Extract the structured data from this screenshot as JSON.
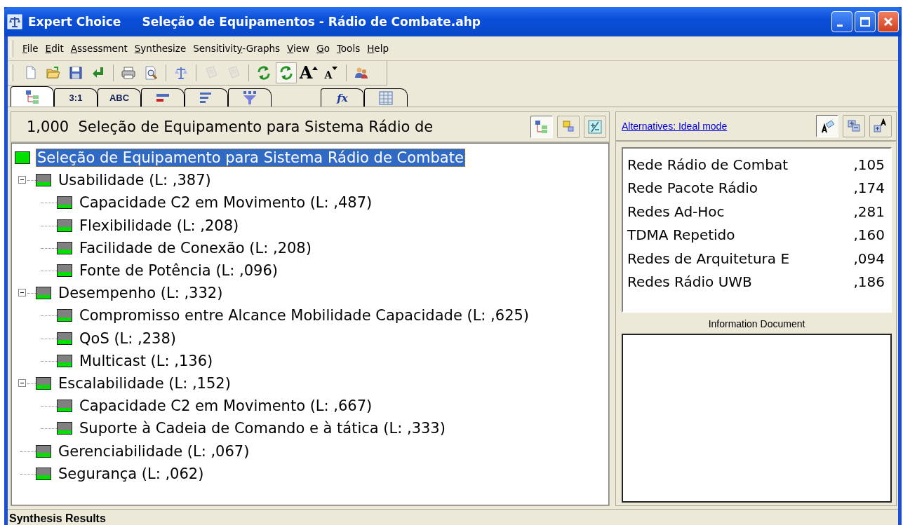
{
  "window": {
    "app": "Expert Choice",
    "title": "Seleção de Equipamentos - Rádio de Combate.ahp"
  },
  "menu": [
    {
      "key": "F",
      "post": "ile"
    },
    {
      "key": "E",
      "post": "dit"
    },
    {
      "key": "A",
      "post": "ssessment"
    },
    {
      "key": "S",
      "post": "ynthesize"
    },
    {
      "pre": "Sensitivit",
      "key": "y",
      "post": "-Graphs"
    },
    {
      "key": "V",
      "post": "iew"
    },
    {
      "key": "G",
      "post": "o"
    },
    {
      "key": "T",
      "post": "ools"
    },
    {
      "key": "H",
      "post": "elp"
    }
  ],
  "toolbar": [
    [
      {
        "pressed": false,
        "disabled": false
      },
      {
        "pressed": false,
        "disabled": false
      },
      {
        "pressed": false,
        "disabled": false
      },
      {
        "pressed": false,
        "disabled": false
      }
    ],
    [
      {
        "pressed": false,
        "disabled": false
      },
      {
        "pressed": false,
        "disabled": false
      }
    ],
    [
      {
        "pressed": false,
        "disabled": false
      }
    ],
    [
      {
        "pressed": false,
        "disabled": true
      },
      {
        "pressed": false,
        "disabled": true
      }
    ],
    [
      {
        "pressed": false,
        "disabled": false
      },
      {
        "pressed": true,
        "disabled": false
      },
      {
        "label": "A",
        "pressed": false,
        "disabled": false
      },
      {
        "label": "A",
        "pressed": false,
        "disabled": false
      }
    ],
    [
      {
        "pressed": false,
        "disabled": false
      }
    ]
  ],
  "tabs": [
    {
      "selected": true
    },
    {
      "label": "3:1",
      "selected": false
    },
    {
      "label": "ABC",
      "selected": false
    },
    {
      "selected": false
    },
    {
      "selected": false
    },
    {
      "selected": false
    },
    {
      "label": "fx",
      "selected": false
    },
    {
      "selected": false
    }
  ],
  "tree_pane": {
    "header": {
      "value": "1,000",
      "label": "Seleção de Equipamento para Sistema Rádio de"
    },
    "view_buttons": [
      {
        "pressed": true
      },
      {
        "pressed": false
      },
      {
        "pressed": false
      }
    ],
    "tree": {
      "label": "Seleção de Equipamento para Sistema Rádio de Combate",
      "selected": true,
      "children": [
        {
          "label": "Usabilidade (L: ,387)",
          "expanded": true,
          "selected": false,
          "children": [
            {
              "label": "Capacidade C2 em Movimento (L: ,487)",
              "selected": false
            },
            {
              "label": "Flexibilidade (L: ,208)",
              "selected": false
            },
            {
              "label": "Facilidade de Conexão (L: ,208)",
              "selected": false
            },
            {
              "label": "Fonte de Potência (L: ,096)",
              "selected": false
            }
          ]
        },
        {
          "label": "Desempenho (L: ,332)",
          "expanded": true,
          "selected": false,
          "children": [
            {
              "label": "Compromisso entre Alcance Mobilidade Capacidade (L: ,625)",
              "selected": false
            },
            {
              "label": "QoS (L: ,238)",
              "selected": false
            },
            {
              "label": "Multicast (L: ,136)",
              "selected": false
            }
          ]
        },
        {
          "label": "Escalabilidade (L: ,152)",
          "expanded": true,
          "selected": false,
          "children": [
            {
              "label": "Capacidade C2 em Movimento (L: ,667)",
              "selected": false
            },
            {
              "label": "Suporte à Cadeia de Comando e à tática (L: ,333)",
              "selected": false
            }
          ]
        },
        {
          "label": "Gerenciabilidade (L: ,067)",
          "selected": false
        },
        {
          "label": "Segurança (L: ,062)",
          "selected": false
        }
      ]
    }
  },
  "alternatives_pane": {
    "link": "Alternatives: Ideal mode",
    "buttons": [
      {
        "pressed": true
      },
      {
        "pressed": false
      },
      {
        "pressed": false
      }
    ],
    "alternatives": [
      {
        "name": "Rede Rádio de Combat",
        "value": ",105"
      },
      {
        "name": "Rede Pacote Rádio",
        "value": ",174"
      },
      {
        "name": "Redes Ad-Hoc",
        "value": ",281"
      },
      {
        "name": "TDMA Repetido",
        "value": ",160"
      },
      {
        "name": "Redes de Arquitetura E",
        "value": ",094"
      },
      {
        "name": "Redes Rádio UWB",
        "value": ",186"
      }
    ],
    "info_label": "Information Document"
  },
  "status_bar": "Synthesis Results"
}
